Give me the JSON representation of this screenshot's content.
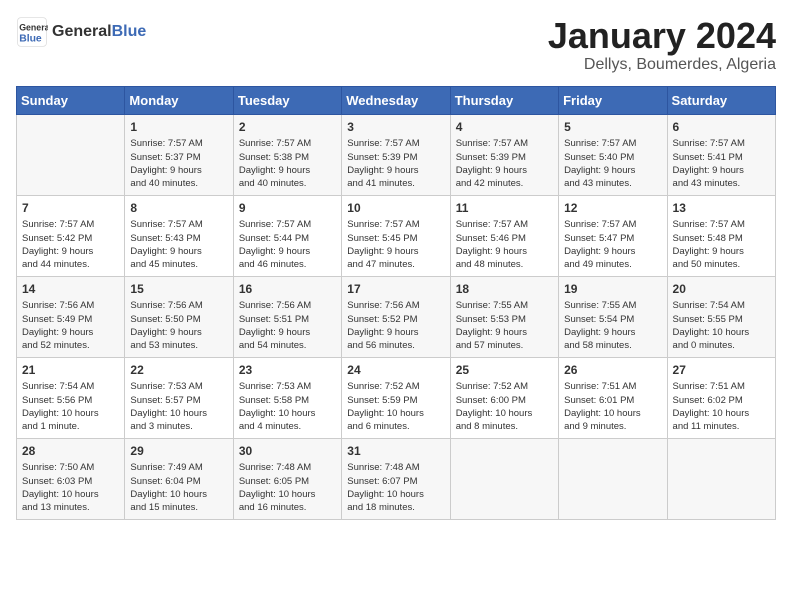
{
  "header": {
    "logo_line1": "General",
    "logo_line2": "Blue",
    "month_title": "January 2024",
    "subtitle": "Dellys, Boumerdes, Algeria"
  },
  "weekdays": [
    "Sunday",
    "Monday",
    "Tuesday",
    "Wednesday",
    "Thursday",
    "Friday",
    "Saturday"
  ],
  "weeks": [
    [
      {
        "day": "",
        "content": ""
      },
      {
        "day": "1",
        "content": "Sunrise: 7:57 AM\nSunset: 5:37 PM\nDaylight: 9 hours\nand 40 minutes."
      },
      {
        "day": "2",
        "content": "Sunrise: 7:57 AM\nSunset: 5:38 PM\nDaylight: 9 hours\nand 40 minutes."
      },
      {
        "day": "3",
        "content": "Sunrise: 7:57 AM\nSunset: 5:39 PM\nDaylight: 9 hours\nand 41 minutes."
      },
      {
        "day": "4",
        "content": "Sunrise: 7:57 AM\nSunset: 5:39 PM\nDaylight: 9 hours\nand 42 minutes."
      },
      {
        "day": "5",
        "content": "Sunrise: 7:57 AM\nSunset: 5:40 PM\nDaylight: 9 hours\nand 43 minutes."
      },
      {
        "day": "6",
        "content": "Sunrise: 7:57 AM\nSunset: 5:41 PM\nDaylight: 9 hours\nand 43 minutes."
      }
    ],
    [
      {
        "day": "7",
        "content": "Sunrise: 7:57 AM\nSunset: 5:42 PM\nDaylight: 9 hours\nand 44 minutes."
      },
      {
        "day": "8",
        "content": "Sunrise: 7:57 AM\nSunset: 5:43 PM\nDaylight: 9 hours\nand 45 minutes."
      },
      {
        "day": "9",
        "content": "Sunrise: 7:57 AM\nSunset: 5:44 PM\nDaylight: 9 hours\nand 46 minutes."
      },
      {
        "day": "10",
        "content": "Sunrise: 7:57 AM\nSunset: 5:45 PM\nDaylight: 9 hours\nand 47 minutes."
      },
      {
        "day": "11",
        "content": "Sunrise: 7:57 AM\nSunset: 5:46 PM\nDaylight: 9 hours\nand 48 minutes."
      },
      {
        "day": "12",
        "content": "Sunrise: 7:57 AM\nSunset: 5:47 PM\nDaylight: 9 hours\nand 49 minutes."
      },
      {
        "day": "13",
        "content": "Sunrise: 7:57 AM\nSunset: 5:48 PM\nDaylight: 9 hours\nand 50 minutes."
      }
    ],
    [
      {
        "day": "14",
        "content": "Sunrise: 7:56 AM\nSunset: 5:49 PM\nDaylight: 9 hours\nand 52 minutes."
      },
      {
        "day": "15",
        "content": "Sunrise: 7:56 AM\nSunset: 5:50 PM\nDaylight: 9 hours\nand 53 minutes."
      },
      {
        "day": "16",
        "content": "Sunrise: 7:56 AM\nSunset: 5:51 PM\nDaylight: 9 hours\nand 54 minutes."
      },
      {
        "day": "17",
        "content": "Sunrise: 7:56 AM\nSunset: 5:52 PM\nDaylight: 9 hours\nand 56 minutes."
      },
      {
        "day": "18",
        "content": "Sunrise: 7:55 AM\nSunset: 5:53 PM\nDaylight: 9 hours\nand 57 minutes."
      },
      {
        "day": "19",
        "content": "Sunrise: 7:55 AM\nSunset: 5:54 PM\nDaylight: 9 hours\nand 58 minutes."
      },
      {
        "day": "20",
        "content": "Sunrise: 7:54 AM\nSunset: 5:55 PM\nDaylight: 10 hours\nand 0 minutes."
      }
    ],
    [
      {
        "day": "21",
        "content": "Sunrise: 7:54 AM\nSunset: 5:56 PM\nDaylight: 10 hours\nand 1 minute."
      },
      {
        "day": "22",
        "content": "Sunrise: 7:53 AM\nSunset: 5:57 PM\nDaylight: 10 hours\nand 3 minutes."
      },
      {
        "day": "23",
        "content": "Sunrise: 7:53 AM\nSunset: 5:58 PM\nDaylight: 10 hours\nand 4 minutes."
      },
      {
        "day": "24",
        "content": "Sunrise: 7:52 AM\nSunset: 5:59 PM\nDaylight: 10 hours\nand 6 minutes."
      },
      {
        "day": "25",
        "content": "Sunrise: 7:52 AM\nSunset: 6:00 PM\nDaylight: 10 hours\nand 8 minutes."
      },
      {
        "day": "26",
        "content": "Sunrise: 7:51 AM\nSunset: 6:01 PM\nDaylight: 10 hours\nand 9 minutes."
      },
      {
        "day": "27",
        "content": "Sunrise: 7:51 AM\nSunset: 6:02 PM\nDaylight: 10 hours\nand 11 minutes."
      }
    ],
    [
      {
        "day": "28",
        "content": "Sunrise: 7:50 AM\nSunset: 6:03 PM\nDaylight: 10 hours\nand 13 minutes."
      },
      {
        "day": "29",
        "content": "Sunrise: 7:49 AM\nSunset: 6:04 PM\nDaylight: 10 hours\nand 15 minutes."
      },
      {
        "day": "30",
        "content": "Sunrise: 7:48 AM\nSunset: 6:05 PM\nDaylight: 10 hours\nand 16 minutes."
      },
      {
        "day": "31",
        "content": "Sunrise: 7:48 AM\nSunset: 6:07 PM\nDaylight: 10 hours\nand 18 minutes."
      },
      {
        "day": "",
        "content": ""
      },
      {
        "day": "",
        "content": ""
      },
      {
        "day": "",
        "content": ""
      }
    ]
  ]
}
